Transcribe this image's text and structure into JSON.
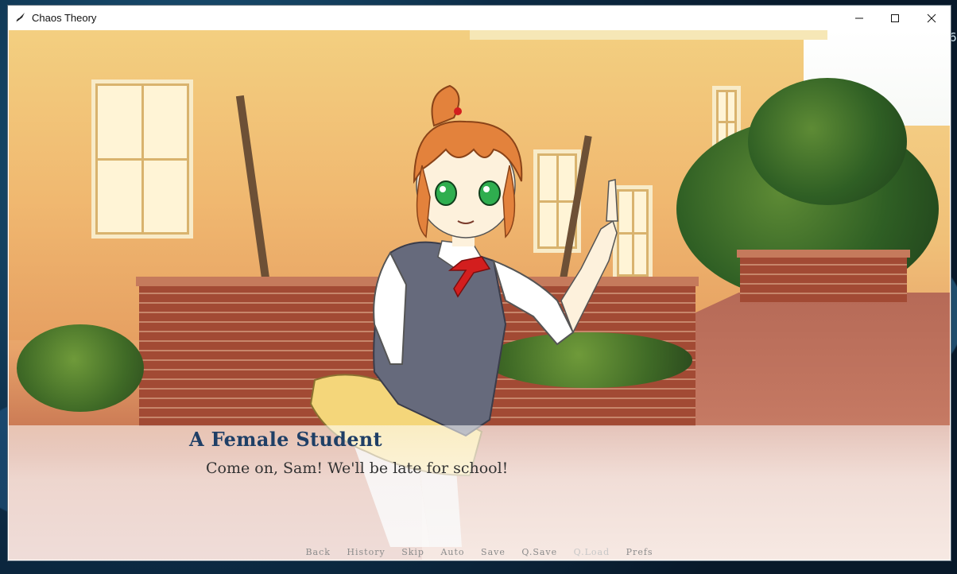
{
  "desktop": {
    "edge_glyph": "6"
  },
  "window": {
    "title": "Chaos Theory",
    "icon": "quill-icon",
    "controls": {
      "minimize": "minimize-icon",
      "maximize": "maximize-icon",
      "close": "close-icon"
    }
  },
  "dialogue": {
    "speaker": "A Female Student",
    "text": "Come on, Sam! We'll be late for school!"
  },
  "quick_menu": [
    {
      "label": "Back",
      "enabled": true
    },
    {
      "label": "History",
      "enabled": true
    },
    {
      "label": "Skip",
      "enabled": true
    },
    {
      "label": "Auto",
      "enabled": true
    },
    {
      "label": "Save",
      "enabled": true
    },
    {
      "label": "Q.Save",
      "enabled": true
    },
    {
      "label": "Q.Load",
      "enabled": false
    },
    {
      "label": "Prefs",
      "enabled": true
    }
  ],
  "colors": {
    "speaker": "#1f3f66",
    "dialogue_text": "#333333",
    "quick_menu_text": "#8b8b8b",
    "quick_menu_disabled": "#c7c7c7"
  }
}
